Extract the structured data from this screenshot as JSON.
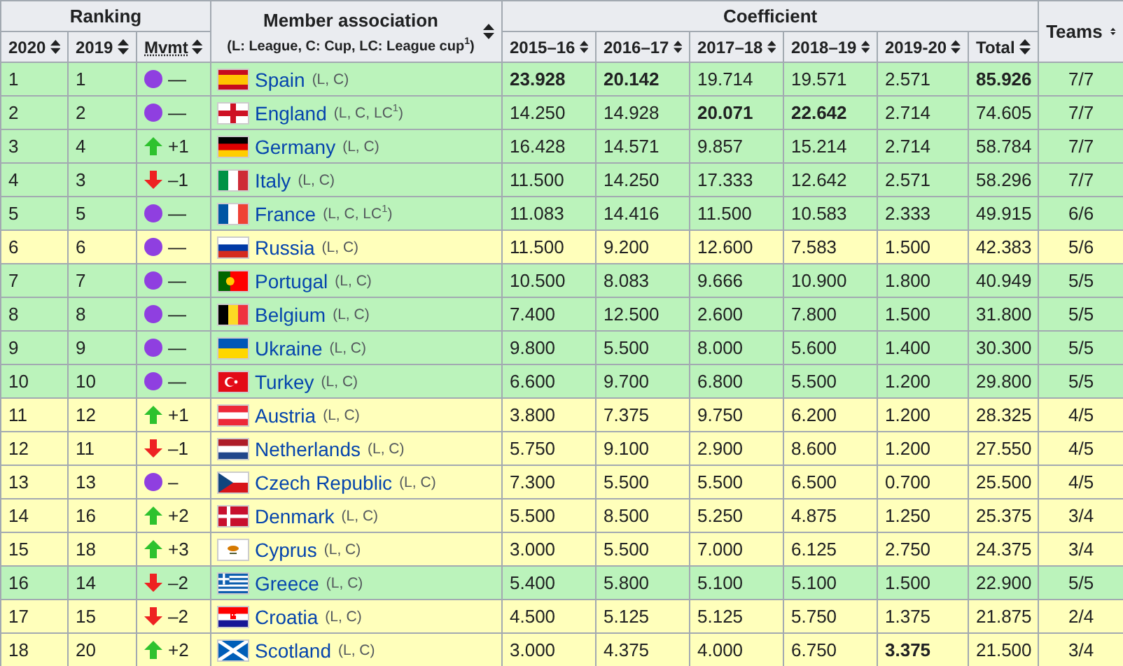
{
  "table": {
    "groups": [
      {
        "label": "Ranking"
      },
      {
        "label": "Member association",
        "note": "(L: League, C: Cup, LC: League cup$^{1}$)"
      },
      {
        "label": "Coefficient"
      },
      {
        "label": "Teams"
      }
    ],
    "columns": [
      "2020",
      "2019",
      "Mvmt",
      "2015–16",
      "2016–17",
      "2017–18",
      "2018–19",
      "2019-20",
      "Total"
    ],
    "rows": [
      {
        "rank_2020": "1",
        "rank_2019": "1",
        "movement": {
          "kind": "same",
          "text": "—"
        },
        "association": "Spain",
        "competitions": "(L, C)",
        "coefficients": [
          {
            "value": "23.928",
            "bold": true
          },
          {
            "value": "20.142",
            "bold": true
          },
          {
            "value": "19.714",
            "bold": false
          },
          {
            "value": "19.571",
            "bold": false
          },
          {
            "value": "2.571",
            "bold": false
          }
        ],
        "total": {
          "value": "85.926",
          "bold": true
        },
        "teams": "7/7",
        "color": "#bbf3bb"
      },
      {
        "rank_2020": "2",
        "rank_2019": "2",
        "movement": {
          "kind": "same",
          "text": "—"
        },
        "association": "England",
        "competitions": "(L, C, LC$^{1}$)",
        "coefficients": [
          {
            "value": "14.250",
            "bold": false
          },
          {
            "value": "14.928",
            "bold": false
          },
          {
            "value": "20.071",
            "bold": true
          },
          {
            "value": "22.642",
            "bold": true
          },
          {
            "value": "2.714",
            "bold": false
          }
        ],
        "total": {
          "value": "74.605",
          "bold": false
        },
        "teams": "7/7",
        "color": "#bbf3bb"
      },
      {
        "rank_2020": "3",
        "rank_2019": "4",
        "movement": {
          "kind": "up",
          "text": "+1"
        },
        "association": "Germany",
        "competitions": "(L, C)",
        "coefficients": [
          {
            "value": "16.428",
            "bold": false
          },
          {
            "value": "14.571",
            "bold": false
          },
          {
            "value": "9.857",
            "bold": false
          },
          {
            "value": "15.214",
            "bold": false
          },
          {
            "value": "2.714",
            "bold": false
          }
        ],
        "total": {
          "value": "58.784",
          "bold": false
        },
        "teams": "7/7",
        "color": "#bbf3bb"
      },
      {
        "rank_2020": "4",
        "rank_2019": "3",
        "movement": {
          "kind": "down",
          "text": "–1"
        },
        "association": "Italy",
        "competitions": "(L, C)",
        "coefficients": [
          {
            "value": "11.500",
            "bold": false
          },
          {
            "value": "14.250",
            "bold": false
          },
          {
            "value": "17.333",
            "bold": false
          },
          {
            "value": "12.642",
            "bold": false
          },
          {
            "value": "2.571",
            "bold": false
          }
        ],
        "total": {
          "value": "58.296",
          "bold": false
        },
        "teams": "7/7",
        "color": "#bbf3bb"
      },
      {
        "rank_2020": "5",
        "rank_2019": "5",
        "movement": {
          "kind": "same",
          "text": "—"
        },
        "association": "France",
        "competitions": "(L, C, LC$^{1}$)",
        "coefficients": [
          {
            "value": "11.083",
            "bold": false
          },
          {
            "value": "14.416",
            "bold": false
          },
          {
            "value": "11.500",
            "bold": false
          },
          {
            "value": "10.583",
            "bold": false
          },
          {
            "value": "2.333",
            "bold": false
          }
        ],
        "total": {
          "value": "49.915",
          "bold": false
        },
        "teams": "6/6",
        "color": "#bbf3bb"
      },
      {
        "rank_2020": "6",
        "rank_2019": "6",
        "movement": {
          "kind": "same",
          "text": "—"
        },
        "association": "Russia",
        "competitions": "(L, C)",
        "coefficients": [
          {
            "value": "11.500",
            "bold": false
          },
          {
            "value": "9.200",
            "bold": false
          },
          {
            "value": "12.600",
            "bold": false
          },
          {
            "value": "7.583",
            "bold": false
          },
          {
            "value": "1.500",
            "bold": false
          }
        ],
        "total": {
          "value": "42.383",
          "bold": false
        },
        "teams": "5/6",
        "color": "#ffffbb"
      },
      {
        "rank_2020": "7",
        "rank_2019": "7",
        "movement": {
          "kind": "same",
          "text": "—"
        },
        "association": "Portugal",
        "competitions": "(L, C)",
        "coefficients": [
          {
            "value": "10.500",
            "bold": false
          },
          {
            "value": "8.083",
            "bold": false
          },
          {
            "value": "9.666",
            "bold": false
          },
          {
            "value": "10.900",
            "bold": false
          },
          {
            "value": "1.800",
            "bold": false
          }
        ],
        "total": {
          "value": "40.949",
          "bold": false
        },
        "teams": "5/5",
        "color": "#bbf3bb"
      },
      {
        "rank_2020": "8",
        "rank_2019": "8",
        "movement": {
          "kind": "same",
          "text": "—"
        },
        "association": "Belgium",
        "competitions": "(L, C)",
        "coefficients": [
          {
            "value": "7.400",
            "bold": false
          },
          {
            "value": "12.500",
            "bold": false
          },
          {
            "value": "2.600",
            "bold": false
          },
          {
            "value": "7.800",
            "bold": false
          },
          {
            "value": "1.500",
            "bold": false
          }
        ],
        "total": {
          "value": "31.800",
          "bold": false
        },
        "teams": "5/5",
        "color": "#bbf3bb"
      },
      {
        "rank_2020": "9",
        "rank_2019": "9",
        "movement": {
          "kind": "same",
          "text": "—"
        },
        "association": "Ukraine",
        "competitions": "(L, C)",
        "coefficients": [
          {
            "value": "9.800",
            "bold": false
          },
          {
            "value": "5.500",
            "bold": false
          },
          {
            "value": "8.000",
            "bold": false
          },
          {
            "value": "5.600",
            "bold": false
          },
          {
            "value": "1.400",
            "bold": false
          }
        ],
        "total": {
          "value": "30.300",
          "bold": false
        },
        "teams": "5/5",
        "color": "#bbf3bb"
      },
      {
        "rank_2020": "10",
        "rank_2019": "10",
        "movement": {
          "kind": "same",
          "text": "—"
        },
        "association": "Turkey",
        "competitions": "(L, C)",
        "coefficients": [
          {
            "value": "6.600",
            "bold": false
          },
          {
            "value": "9.700",
            "bold": false
          },
          {
            "value": "6.800",
            "bold": false
          },
          {
            "value": "5.500",
            "bold": false
          },
          {
            "value": "1.200",
            "bold": false
          }
        ],
        "total": {
          "value": "29.800",
          "bold": false
        },
        "teams": "5/5",
        "color": "#bbf3bb"
      },
      {
        "rank_2020": "11",
        "rank_2019": "12",
        "movement": {
          "kind": "up",
          "text": "+1"
        },
        "association": "Austria",
        "competitions": "(L, C)",
        "coefficients": [
          {
            "value": "3.800",
            "bold": false
          },
          {
            "value": "7.375",
            "bold": false
          },
          {
            "value": "9.750",
            "bold": false
          },
          {
            "value": "6.200",
            "bold": false
          },
          {
            "value": "1.200",
            "bold": false
          }
        ],
        "total": {
          "value": "28.325",
          "bold": false
        },
        "teams": "4/5",
        "color": "#ffffbb"
      },
      {
        "rank_2020": "12",
        "rank_2019": "11",
        "movement": {
          "kind": "down",
          "text": "–1"
        },
        "association": "Netherlands",
        "competitions": "(L, C)",
        "coefficients": [
          {
            "value": "5.750",
            "bold": false
          },
          {
            "value": "9.100",
            "bold": false
          },
          {
            "value": "2.900",
            "bold": false
          },
          {
            "value": "8.600",
            "bold": false
          },
          {
            "value": "1.200",
            "bold": false
          }
        ],
        "total": {
          "value": "27.550",
          "bold": false
        },
        "teams": "4/5",
        "color": "#ffffbb"
      },
      {
        "rank_2020": "13",
        "rank_2019": "13",
        "movement": {
          "kind": "same",
          "text": "–"
        },
        "association": "Czech Republic",
        "competitions": "(L, C)",
        "coefficients": [
          {
            "value": "7.300",
            "bold": false
          },
          {
            "value": "5.500",
            "bold": false
          },
          {
            "value": "5.500",
            "bold": false
          },
          {
            "value": "6.500",
            "bold": false
          },
          {
            "value": "0.700",
            "bold": false
          }
        ],
        "total": {
          "value": "25.500",
          "bold": false
        },
        "teams": "4/5",
        "color": "#ffffbb"
      },
      {
        "rank_2020": "14",
        "rank_2019": "16",
        "movement": {
          "kind": "up",
          "text": "+2"
        },
        "association": "Denmark",
        "competitions": "(L, C)",
        "coefficients": [
          {
            "value": "5.500",
            "bold": false
          },
          {
            "value": "8.500",
            "bold": false
          },
          {
            "value": "5.250",
            "bold": false
          },
          {
            "value": "4.875",
            "bold": false
          },
          {
            "value": "1.250",
            "bold": false
          }
        ],
        "total": {
          "value": "25.375",
          "bold": false
        },
        "teams": "3/4",
        "color": "#ffffbb"
      },
      {
        "rank_2020": "15",
        "rank_2019": "18",
        "movement": {
          "kind": "up",
          "text": "+3"
        },
        "association": "Cyprus",
        "competitions": "(L, C)",
        "coefficients": [
          {
            "value": "3.000",
            "bold": false
          },
          {
            "value": "5.500",
            "bold": false
          },
          {
            "value": "7.000",
            "bold": false
          },
          {
            "value": "6.125",
            "bold": false
          },
          {
            "value": "2.750",
            "bold": false
          }
        ],
        "total": {
          "value": "24.375",
          "bold": false
        },
        "teams": "3/4",
        "color": "#ffffbb"
      },
      {
        "rank_2020": "16",
        "rank_2019": "14",
        "movement": {
          "kind": "down",
          "text": "–2"
        },
        "association": "Greece",
        "competitions": "(L, C)",
        "coefficients": [
          {
            "value": "5.400",
            "bold": false
          },
          {
            "value": "5.800",
            "bold": false
          },
          {
            "value": "5.100",
            "bold": false
          },
          {
            "value": "5.100",
            "bold": false
          },
          {
            "value": "1.500",
            "bold": false
          }
        ],
        "total": {
          "value": "22.900",
          "bold": false
        },
        "teams": "5/5",
        "color": "#bbf3bb"
      },
      {
        "rank_2020": "17",
        "rank_2019": "15",
        "movement": {
          "kind": "down",
          "text": "–2"
        },
        "association": "Croatia",
        "competitions": "(L, C)",
        "coefficients": [
          {
            "value": "4.500",
            "bold": false
          },
          {
            "value": "5.125",
            "bold": false
          },
          {
            "value": "5.125",
            "bold": false
          },
          {
            "value": "5.750",
            "bold": false
          },
          {
            "value": "1.375",
            "bold": false
          }
        ],
        "total": {
          "value": "21.875",
          "bold": false
        },
        "teams": "2/4",
        "color": "#ffffbb"
      },
      {
        "rank_2020": "18",
        "rank_2019": "20",
        "movement": {
          "kind": "up",
          "text": "+2"
        },
        "association": "Scotland",
        "competitions": "(L, C)",
        "coefficients": [
          {
            "value": "3.000",
            "bold": false
          },
          {
            "value": "4.375",
            "bold": false
          },
          {
            "value": "4.000",
            "bold": false
          },
          {
            "value": "6.750",
            "bold": false
          },
          {
            "value": "3.375",
            "bold": true
          }
        ],
        "total": {
          "value": "21.500",
          "bold": false
        },
        "teams": "3/4",
        "color": "#ffffbb"
      }
    ]
  }
}
